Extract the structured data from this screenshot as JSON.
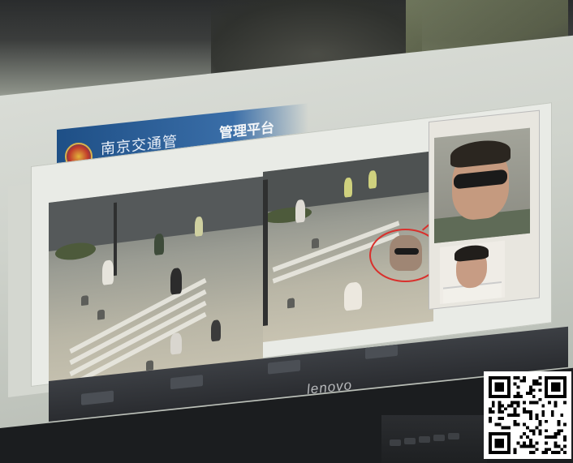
{
  "app": {
    "header_title": "南京交通管",
    "header_title_2": "管理平台",
    "window_title": "",
    "brand": "lenovo"
  },
  "colors": {
    "header_blue": "#1e4f86",
    "highlight_red": "#d9302c",
    "taskbar": "#2a2c30"
  },
  "icons": {
    "police_badge": "police-badge-icon",
    "close": "close-icon",
    "qr": "qr-code"
  },
  "panels": {
    "captured_face": "face-capture",
    "reference_face": "reference-photo"
  }
}
